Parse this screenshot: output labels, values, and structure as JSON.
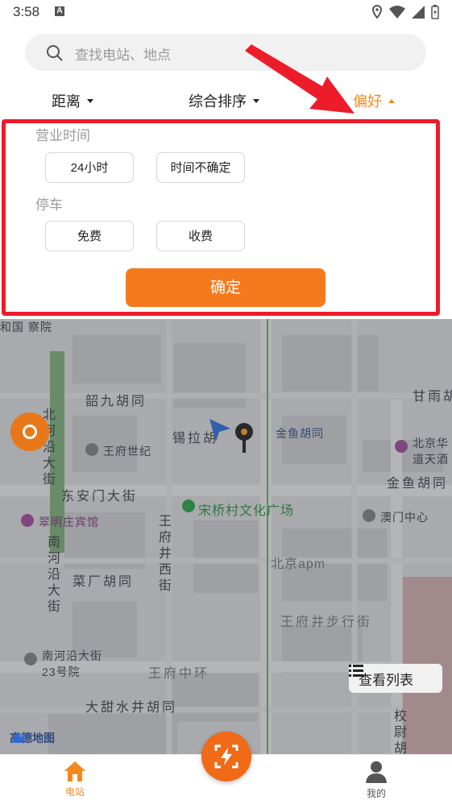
{
  "status_bar": {
    "time": "3:58",
    "notification_icon": "a-icon",
    "icons": [
      "location-icon",
      "wifi-icon",
      "signal-icon",
      "battery-icon"
    ]
  },
  "search": {
    "placeholder": "查找电站、地点"
  },
  "filters": {
    "distance": "距离",
    "sort": "综合排序",
    "preference": "偏好"
  },
  "preference_panel": {
    "business_hours_title": "营业时间",
    "business_hours_options": [
      "24小时",
      "时间不确定"
    ],
    "parking_title": "停车",
    "parking_options": [
      "免费",
      "收费"
    ],
    "confirm_label": "确定"
  },
  "map": {
    "labels": {
      "top_left": "和国\n察院",
      "shaojiu": "韶九胡同",
      "xila": "锡拉胡",
      "jinyu": "金鱼胡同",
      "ganyu": "甘雨胡",
      "wangfu_shiji": "王府世纪",
      "beijing_hotel": "北京华\n道天酒",
      "dongan": "东安门大街",
      "jinyu2": "金鱼胡同",
      "songqiao": "宋桥村文化广场",
      "cuiming": "翠明庄宾馆",
      "aomen": "澳门中心",
      "beijing_apm": "北京apm",
      "caichang": "菜厂胡同",
      "wangfujing_west": "王府井西街",
      "nanheyan_v": "南河沿大街",
      "north_v": "北河沿大街",
      "wangfujing_walk": "王府井步行街",
      "nanheyan23": "南河沿大街\n23号院",
      "wangfu_zhonghuan": "王府中环",
      "datianshui": "大甜水井胡同",
      "xiaowei": "校尉胡"
    },
    "view_list_label": "查看列表",
    "logo_text": "高德地图"
  },
  "bottom_nav": {
    "home_label": "电站",
    "me_label": "我的"
  },
  "colors": {
    "accent": "#f5891f",
    "confirm": "#f57a1e",
    "annotation": "#ec1c2a"
  }
}
